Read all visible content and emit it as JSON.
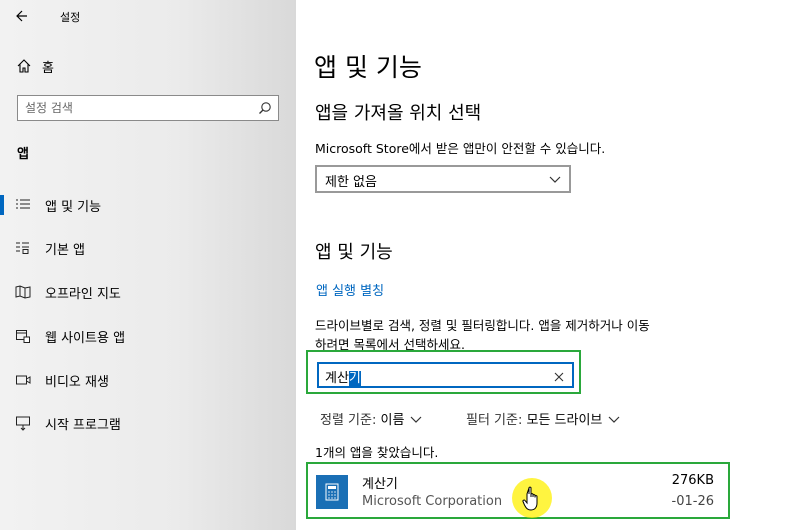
{
  "window": {
    "title": "설정"
  },
  "sidebar": {
    "home_label": "홈",
    "search_placeholder": "설정 검색",
    "section_label": "앱",
    "items": [
      {
        "label": "앱 및 기능",
        "icon": "list-icon",
        "active": true
      },
      {
        "label": "기본 앱",
        "icon": "default-apps-icon",
        "active": false
      },
      {
        "label": "오프라인 지도",
        "icon": "map-icon",
        "active": false
      },
      {
        "label": "웹 사이트용 앱",
        "icon": "website-app-icon",
        "active": false
      },
      {
        "label": "비디오 재생",
        "icon": "video-icon",
        "active": false
      },
      {
        "label": "시작 프로그램",
        "icon": "startup-icon",
        "active": false
      }
    ]
  },
  "main": {
    "title": "앱 및 기능",
    "source_heading": "앱을 가져올 위치 선택",
    "source_desc": "Microsoft Store에서 받은 앱만이 안전할 수 있습니다.",
    "source_value": "제한 없음",
    "apps_heading": "앱 및 기능",
    "alias_link": "앱 실행 별칭",
    "apps_desc_line1": "드라이브별로 검색, 정렬 및 필터링합니다. 앱을 제거하거나 이동",
    "apps_desc_line2": "하려면 목록에서 선택하세요.",
    "search_value_plain": "계산",
    "search_value_selected": "기",
    "sort_label": "정렬 기준:",
    "sort_value": "이름",
    "filter_label": "필터 기준:",
    "filter_value": "모든 드라이브",
    "result_count": "1개의 앱을 찾았습니다.",
    "app": {
      "name": "계산기",
      "publisher": "Microsoft Corporation",
      "size": "276KB",
      "date": "-01-26",
      "icon": "calculator-icon"
    }
  },
  "colors": {
    "accent": "#0067c0",
    "highlight_box": "#2aa83b",
    "cursor_halo": "#fff000"
  }
}
